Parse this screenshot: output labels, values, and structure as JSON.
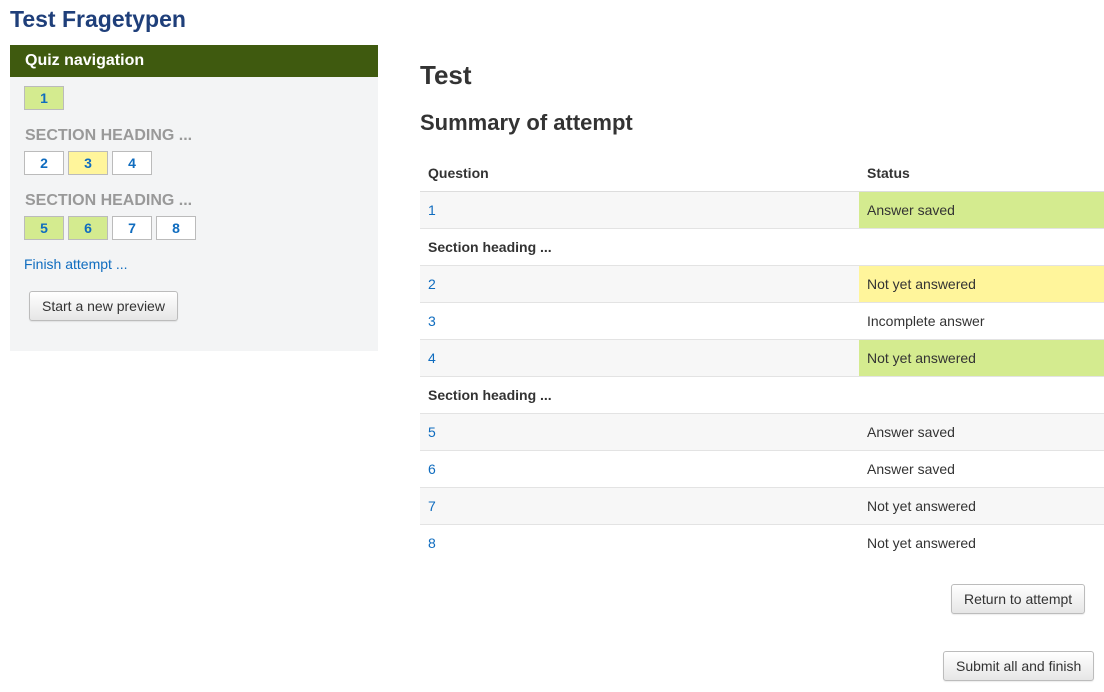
{
  "course_title": "Test Fragetypen",
  "quiz_nav": {
    "header": "Quiz navigation",
    "first_question": "1",
    "sections": [
      {
        "heading": "SECTION HEADING ...",
        "questions": [
          "2",
          "3",
          "4"
        ]
      },
      {
        "heading": "SECTION HEADING ...",
        "questions": [
          "5",
          "6",
          "7",
          "8"
        ]
      }
    ],
    "finish_link": "Finish attempt ...",
    "preview_button": "Start a new preview"
  },
  "main": {
    "heading": "Test",
    "summary_heading": "Summary of attempt",
    "columns": {
      "question": "Question",
      "status": "Status"
    },
    "rows": [
      {
        "question": "1",
        "status": "Answer saved"
      },
      {
        "section": "Section heading ..."
      },
      {
        "question": "2",
        "status": "Not yet answered"
      },
      {
        "question": "3",
        "status": "Incomplete answer"
      },
      {
        "question": "4",
        "status": "Not yet answered"
      },
      {
        "section": "Section heading ..."
      },
      {
        "question": "5",
        "status": "Answer saved"
      },
      {
        "question": "6",
        "status": "Answer saved"
      },
      {
        "question": "7",
        "status": "Not yet answered"
      },
      {
        "question": "8",
        "status": "Not yet answered"
      }
    ],
    "return_button": "Return to attempt",
    "submit_button": "Submit all and finish"
  },
  "colors": {
    "header_green": "#3f5a0f",
    "title_blue": "#1f3f7a",
    "link_blue": "#0f6cbf",
    "saved_green": "#d4eb8f",
    "current_yellow": "#fff59b"
  }
}
